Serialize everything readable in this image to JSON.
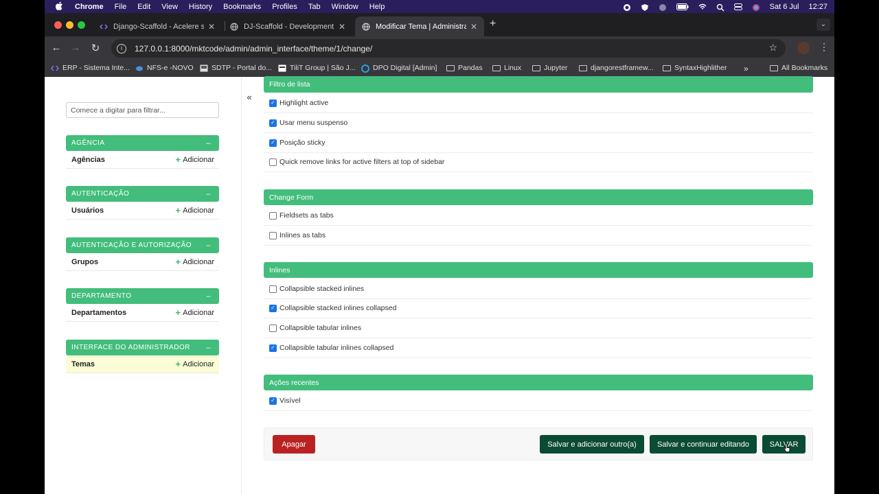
{
  "menubar": {
    "app": "Chrome",
    "items": [
      "File",
      "Edit",
      "View",
      "History",
      "Bookmarks",
      "Profiles",
      "Tab",
      "Window",
      "Help"
    ],
    "date": "Sat 6 Jul",
    "time": "12:27"
  },
  "tabs": [
    {
      "title": "Django-Scaffold - Acelere se",
      "icon": "code-icon"
    },
    {
      "title": "DJ-Scaffold - Development",
      "icon": "globe-icon"
    },
    {
      "title": "Modificar Tema | Administraç",
      "icon": "globe-icon"
    }
  ],
  "url": "127.0.0.1:8000/mktcode/admin/admin_interface/theme/1/change/",
  "bookmarks": [
    {
      "label": "ERP - Sistema Inte...",
      "icon": "code-icon"
    },
    {
      "label": "NFS-e -NOVO",
      "icon": "cloud-icon"
    },
    {
      "label": "SDTP - Portal do...",
      "icon": "site-icon"
    },
    {
      "label": "TiliT Group | São J...",
      "icon": "site-icon"
    },
    {
      "label": "DPO Digital [Admin]",
      "icon": "circle-icon"
    },
    {
      "label": "Pandas",
      "icon": "folder-icon"
    },
    {
      "label": "Linux",
      "icon": "folder-icon"
    },
    {
      "label": "Jupyter",
      "icon": "folder-icon"
    },
    {
      "label": "djangorestframew...",
      "icon": "folder-icon"
    },
    {
      "label": "SyntaxHighlither",
      "icon": "folder-icon"
    }
  ],
  "all_bookmarks": "All Bookmarks",
  "sidebar": {
    "filter_placeholder": "Comece a digitar para filtrar...",
    "collapse_glyph": "«",
    "add_label": "Adicionar",
    "modules": [
      {
        "header": "AGÊNCIA",
        "model": "Agências"
      },
      {
        "header": "AUTENTICAÇÃO",
        "model": "Usuários"
      },
      {
        "header": "AUTENTICAÇÃO E AUTORIZAÇÃO",
        "model": "Grupos"
      },
      {
        "header": "DEPARTAMENTO",
        "model": "Departamentos"
      },
      {
        "header": "INTERFACE DO ADMINISTRADOR",
        "model": "Temas"
      }
    ]
  },
  "fieldsets": [
    {
      "title": "Filtro de lista",
      "fields": [
        {
          "label": "Highlight active",
          "checked": true
        },
        {
          "label": "Usar menu suspenso",
          "checked": true
        },
        {
          "label": "Posição sticky",
          "checked": true
        },
        {
          "label": "Quick remove links for active filters at top of sidebar",
          "checked": false
        }
      ]
    },
    {
      "title": "Change Form",
      "fields": [
        {
          "label": "Fieldsets as tabs",
          "checked": false
        },
        {
          "label": "Inlines as tabs",
          "checked": false
        }
      ]
    },
    {
      "title": "Inlines",
      "fields": [
        {
          "label": "Collapsible stacked inlines",
          "checked": false
        },
        {
          "label": "Collapsible stacked inlines collapsed",
          "checked": true
        },
        {
          "label": "Collapsible tabular inlines",
          "checked": false
        },
        {
          "label": "Collapsible tabular inlines collapsed",
          "checked": true
        }
      ]
    },
    {
      "title": "Ações recentes",
      "fields": [
        {
          "label": "Visível",
          "checked": true
        }
      ]
    }
  ],
  "actions": {
    "delete": "Apagar",
    "save_add": "Salvar e adicionar outro(a)",
    "save_continue": "Salvar e continuar editando",
    "save": "SALVAR"
  }
}
